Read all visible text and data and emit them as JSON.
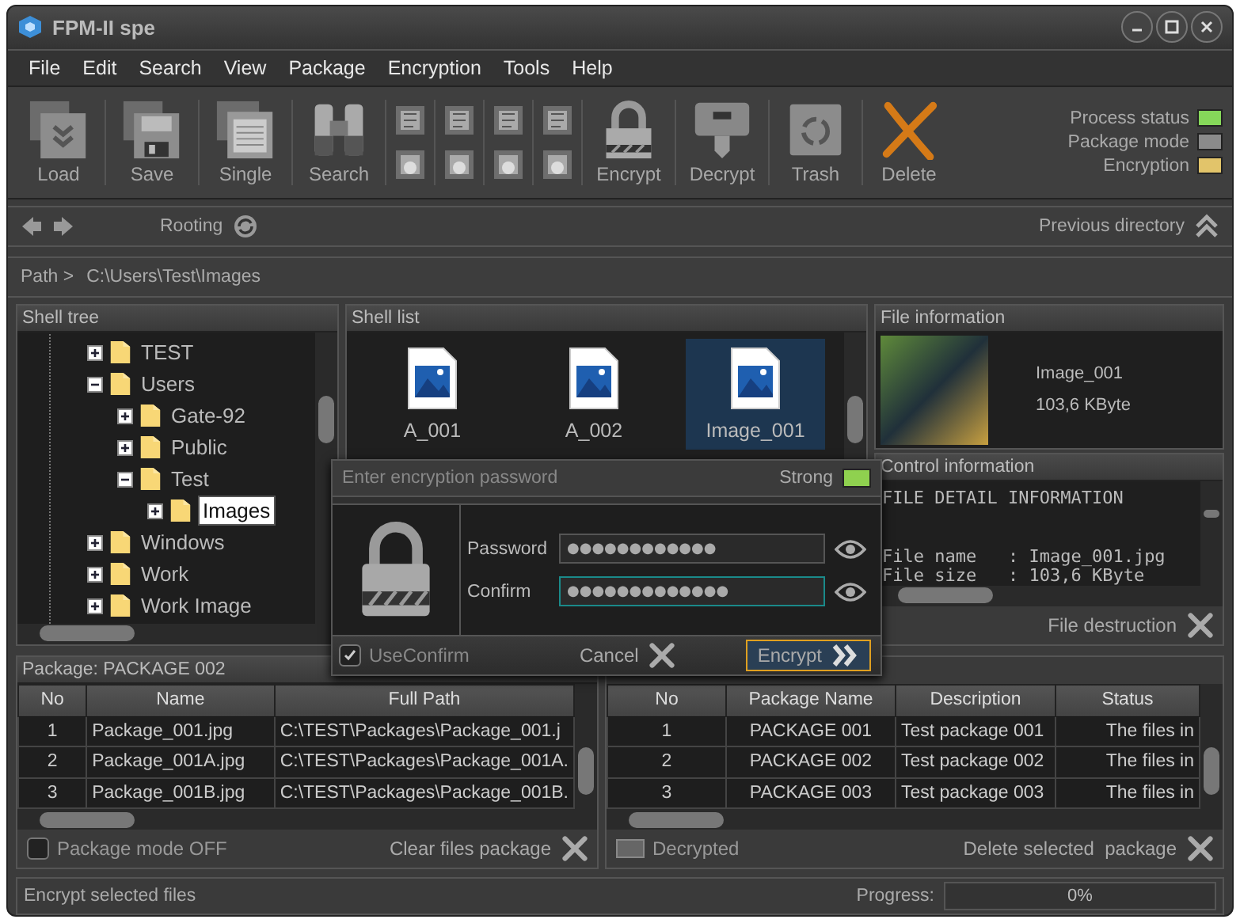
{
  "window": {
    "title": "FPM-II spe"
  },
  "menu": [
    "File",
    "Edit",
    "Search",
    "View",
    "Package",
    "Encryption",
    "Tools",
    "Help"
  ],
  "toolbar": {
    "left_buttons": [
      "Load",
      "Save",
      "Single",
      "Search"
    ],
    "right_buttons": [
      "Encrypt",
      "Decrypt",
      "Trash",
      "Delete"
    ],
    "status_lights": [
      {
        "label": "Process status",
        "color": "#86d85a"
      },
      {
        "label": "Package mode",
        "color": "#8a8a8a"
      },
      {
        "label": "Encryption",
        "color": "#e2c46a"
      }
    ]
  },
  "nav": {
    "rooting": "Rooting",
    "previous": "Previous directory"
  },
  "path": {
    "label": "Path >",
    "value": "C:\\Users\\Test\\Images"
  },
  "shell_tree": {
    "title": "Shell tree",
    "items": [
      {
        "label": "TEST",
        "expanded": false,
        "selected": false
      },
      {
        "label": "Users",
        "expanded": true,
        "selected": false,
        "children": [
          {
            "label": "Gate-92",
            "expanded": false,
            "selected": false
          },
          {
            "label": "Public",
            "expanded": false,
            "selected": false
          },
          {
            "label": "Test",
            "expanded": true,
            "selected": false,
            "children": [
              {
                "label": "Images",
                "expanded": false,
                "selected": true
              }
            ]
          }
        ]
      },
      {
        "label": "Windows",
        "expanded": false,
        "selected": false
      },
      {
        "label": "Work",
        "expanded": false,
        "selected": false
      },
      {
        "label": "Work Image",
        "expanded": false,
        "selected": false
      }
    ]
  },
  "shell_list": {
    "title": "Shell list",
    "items": [
      {
        "name": "A_001",
        "selected": false
      },
      {
        "name": "A_002",
        "selected": false
      },
      {
        "name": "Image_001",
        "selected": true
      }
    ]
  },
  "file_information": {
    "title": "File information",
    "name": "Image_001",
    "size": "103,6 KByte"
  },
  "control_information": {
    "title": "Control information",
    "heading": "FILE DETAIL INFORMATION",
    "lines": [
      "File name   : Image_001.jpg",
      "File size   : 103,6 KByte"
    ],
    "action": "File destruction"
  },
  "password_dialog": {
    "title": "Enter encryption password",
    "strength": {
      "label": "Strong",
      "color": "#8fd14f"
    },
    "fields": [
      {
        "label": "Password",
        "value": "●●●●●●●●●●●●",
        "focused": false
      },
      {
        "label": "Confirm",
        "value": "●●●●●●●●●●●●●",
        "focused": true
      }
    ],
    "use_confirm": {
      "label": "UseConfirm",
      "checked": true
    },
    "buttons": [
      {
        "kind": "cancel",
        "label": "Cancel"
      },
      {
        "kind": "encrypt",
        "label": "Encrypt"
      }
    ]
  },
  "package_files": {
    "title": "Package: PACKAGE 002",
    "columns": [
      "No",
      "Name",
      "Full Path"
    ],
    "rows": [
      [
        "1",
        "Package_001.jpg",
        "C:\\TEST\\Packages\\Package_001.j"
      ],
      [
        "2",
        "Package_001A.jpg",
        "C:\\TEST\\Packages\\Package_001A."
      ],
      [
        "3",
        "Package_001B.jpg",
        "C:\\TEST\\Packages\\Package_001B."
      ]
    ],
    "mode": {
      "label": "Package mode OFF",
      "checked": false
    },
    "clear": "Clear files package"
  },
  "packages": {
    "columns": [
      "No",
      "Package Name",
      "Description",
      "Status"
    ],
    "rows": [
      [
        "1",
        "PACKAGE 001",
        "Test package 001",
        "The files in"
      ],
      [
        "2",
        "PACKAGE 002",
        "Test package 002",
        "The files in"
      ],
      [
        "3",
        "PACKAGE 003",
        "Test package 003",
        "The files in"
      ]
    ],
    "decrypted": {
      "label": "Decrypted",
      "on": false
    },
    "delete": "Delete selected  package"
  },
  "status_bar": {
    "message": "Encrypt selected files",
    "progress_label": "Progress:",
    "progress": {
      "level": 0,
      "reading": "0%"
    }
  }
}
